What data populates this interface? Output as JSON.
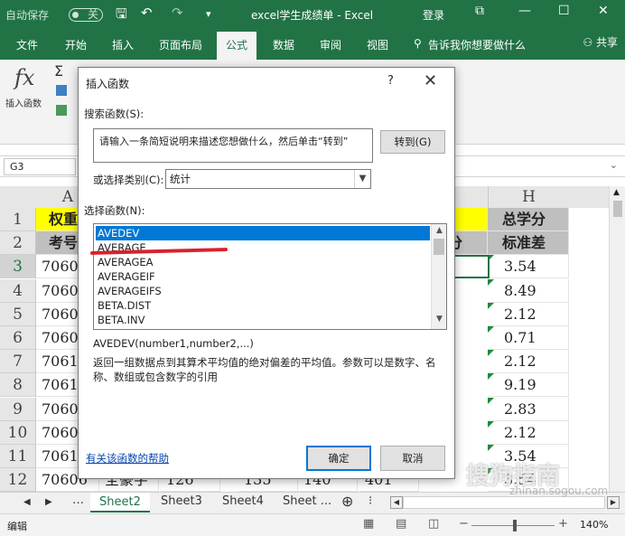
{
  "titlebar": {
    "autosave": "自动保存",
    "toggle": "关",
    "title": "excel学生成绩单 - Excel",
    "login": "登录"
  },
  "ribbon_tabs": [
    "文件",
    "开始",
    "插入",
    "页面布局",
    "公式",
    "数据",
    "审阅",
    "视图"
  ],
  "tell_me": "告诉我你想要做什么",
  "share": "共享",
  "ribbon": {
    "insert_function": "插入函数"
  },
  "formula_bar": {
    "name_box": "G3"
  },
  "columns": {
    "A": "A",
    "H": "H"
  },
  "rows": [
    "1",
    "2",
    "3",
    "4",
    "5",
    "6",
    "7",
    "8",
    "9",
    "10",
    "11",
    "12"
  ],
  "cells": {
    "A1": "权重",
    "A2": "考号",
    "G2": "分",
    "H1": "总学分",
    "H2": "标准差",
    "A_ids": [
      "7060",
      "7060",
      "7060",
      "7060",
      "7061",
      "7061",
      "7060",
      "7060",
      "7061",
      "70606"
    ],
    "H_values": [
      "3.54",
      "8.49",
      "2.12",
      "0.71",
      "2.12",
      "9.19",
      "2.83",
      "2.12",
      "3.54",
      "3.54"
    ],
    "row12": [
      "全豪字",
      "126",
      "135",
      "140",
      "401"
    ]
  },
  "sheet_tabs": [
    "Sheet2",
    "Sheet3",
    "Sheet4",
    "Sheet ..."
  ],
  "status": {
    "mode": "编辑",
    "zoom": "140%"
  },
  "dialog": {
    "title": "插入函数",
    "help": "?",
    "search_label": "搜索函数(S):",
    "search_text": "请输入一条简短说明来描述您想做什么，然后单击“转到”",
    "goto_button": "转到(G)",
    "category_label": "或选择类别(C):",
    "category_value": "统计",
    "function_label": "选择函数(N):",
    "functions": [
      "AVEDEV",
      "AVERAGE",
      "AVERAGEA",
      "AVERAGEIF",
      "AVERAGEIFS",
      "BETA.DIST",
      "BETA.INV"
    ],
    "signature": "AVEDEV(number1,number2,...)",
    "description": "返回一组数据点到其算术平均值的绝对偏差的平均值。参数可以是数字、名称、数组或包含数字的引用",
    "help_link": "有关该函数的帮助",
    "ok": "确定",
    "cancel": "取消"
  },
  "watermark": "搜狗指南",
  "watermark_url": "zhinan.sogou.com"
}
